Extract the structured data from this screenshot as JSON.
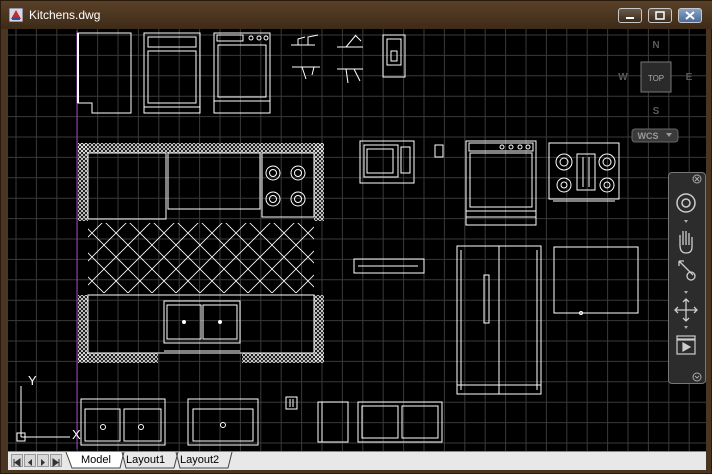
{
  "window": {
    "title": "Kitchens.dwg"
  },
  "viewcube": {
    "face_label": "TOP",
    "north": "N",
    "south": "S",
    "east": "E",
    "west": "W",
    "ucs_label": "WCS"
  },
  "ucs_axis": {
    "y_label": "Y",
    "x_label": "X"
  },
  "tabs": [
    {
      "label": "Model",
      "active": true
    },
    {
      "label": "Layout1",
      "active": false
    },
    {
      "label": "Layout2",
      "active": false
    }
  ],
  "navigation_bar": {
    "tools": [
      "steering-wheel-icon",
      "pan-icon",
      "zoom-icon",
      "orbit-icon",
      "showmotion-icon"
    ]
  },
  "colors": {
    "grid": "#3a3a3a",
    "linework": "#ffffff",
    "ucs_line": "#a040c0",
    "canvas_bg": "#000000",
    "frame": "#4a3520"
  }
}
